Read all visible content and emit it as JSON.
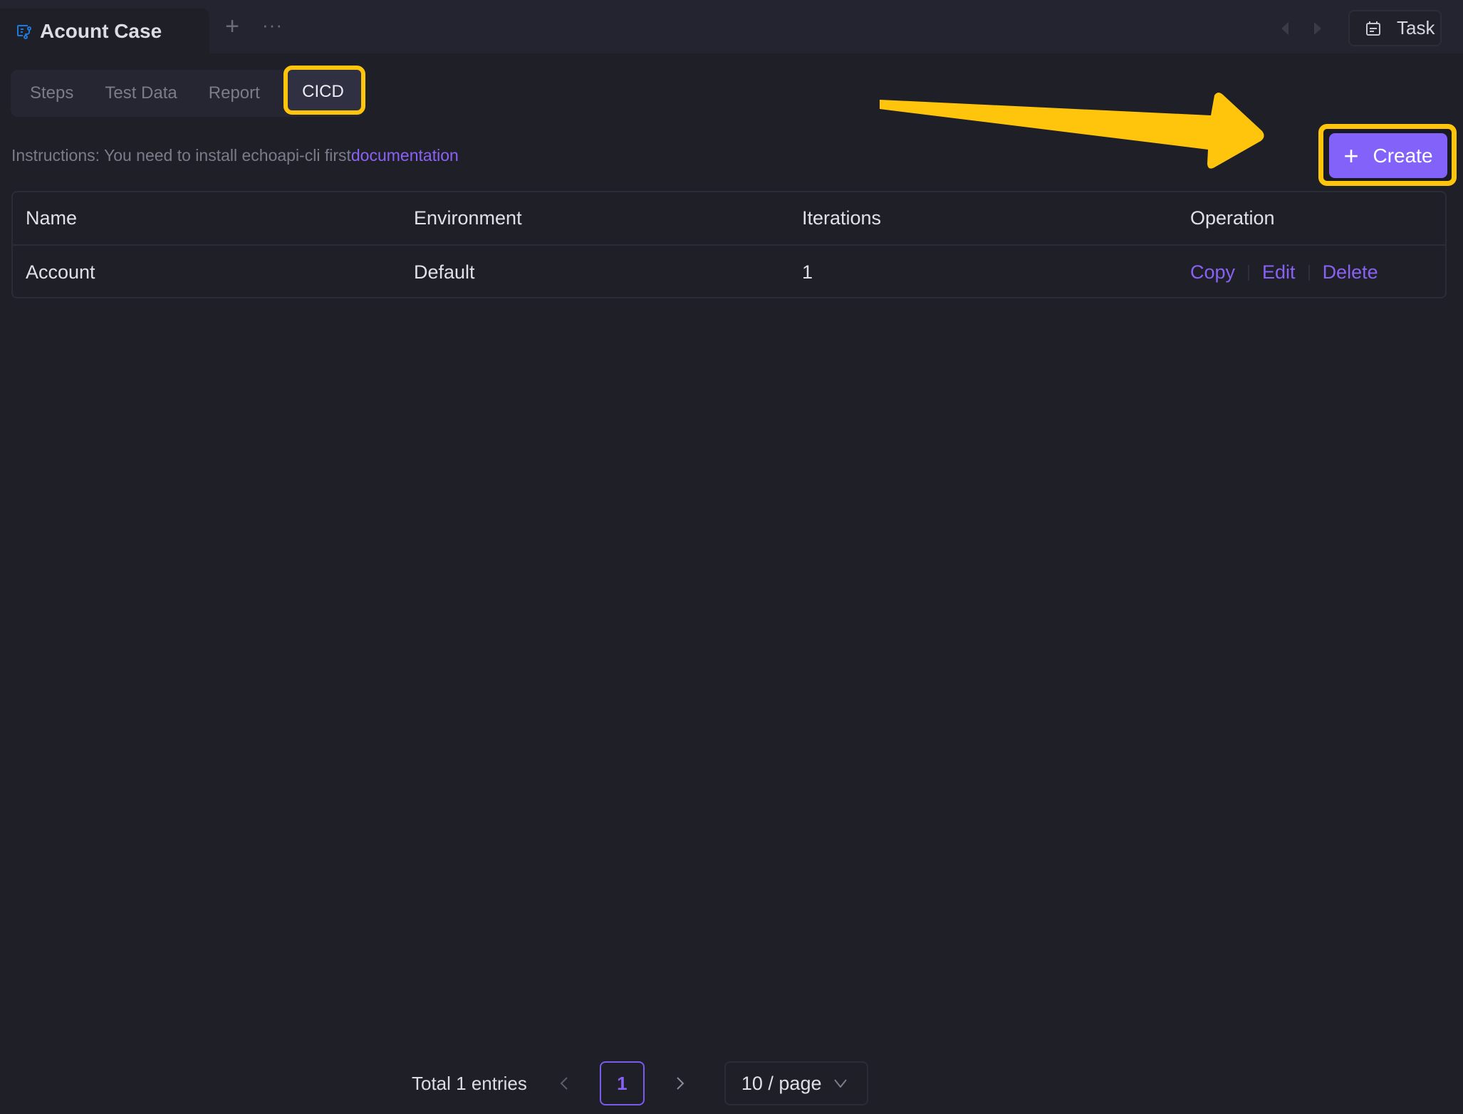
{
  "top_bar": {
    "tab_title": "Acount Case",
    "tab_icon": "test-case-flow-icon",
    "add_tab_icon": "plus-icon",
    "more_icon": "ellipsis-icon",
    "nav_back_icon": "caret-left-icon",
    "nav_forward_icon": "caret-right-icon",
    "task_button": {
      "label": "Task",
      "icon": "calendar-icon"
    }
  },
  "sub_tabs": [
    {
      "label": "Steps",
      "active": false
    },
    {
      "label": "Test Data",
      "active": false
    },
    {
      "label": "Report",
      "active": false
    },
    {
      "label": "CICD",
      "active": true
    }
  ],
  "instructions": {
    "text": "Instructions: You need to install echoapi-cli first",
    "link_label": "documentation"
  },
  "create_button": {
    "label": "Create",
    "icon": "plus-icon"
  },
  "table": {
    "columns": [
      "Name",
      "Environment",
      "Iterations",
      "Operation"
    ],
    "rows": [
      {
        "name": "Account",
        "environment": "Default",
        "iterations": "1",
        "operations": [
          "Copy",
          "Edit",
          "Delete"
        ]
      }
    ]
  },
  "pagination": {
    "total_label": "Total 1 entries",
    "current_page": "1",
    "page_size_label": "10 / page"
  },
  "annotations": {
    "highlight_color": "#ffc50d",
    "accent_color": "#8262f8"
  }
}
